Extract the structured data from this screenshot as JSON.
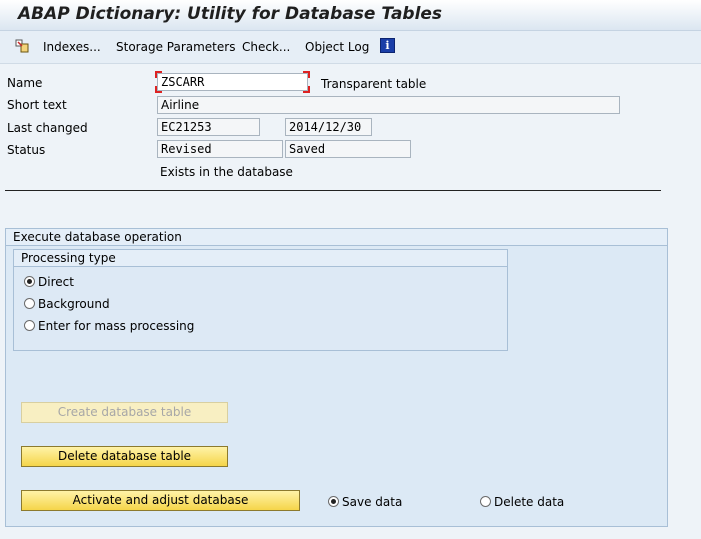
{
  "window": {
    "title": "ABAP Dictionary: Utility for Database Tables"
  },
  "toolbar": {
    "display_icon": "display-object-icon",
    "indexes_label": "Indexes...",
    "storage_label": "Storage Parameters",
    "check_label": "Check...",
    "object_log_label": "Object Log",
    "info_icon": "info-icon"
  },
  "header": {
    "name_label": "Name",
    "name_value": "ZSCARR",
    "table_type": "Transparent table",
    "short_text_label": "Short text",
    "short_text_value": "Airline",
    "last_changed_label": "Last changed",
    "last_changed_user": "EC21253",
    "last_changed_date": "2014/12/30",
    "status_label": "Status",
    "status_value1": "Revised",
    "status_value2": "Saved",
    "db_state": "Exists in the database"
  },
  "operation": {
    "group_title": "Execute database operation",
    "processing": {
      "group_title": "Processing type",
      "options": [
        {
          "label": "Direct",
          "selected": true
        },
        {
          "label": "Background",
          "selected": false
        },
        {
          "label": "Enter for mass processing",
          "selected": false
        }
      ]
    },
    "create_button": "Create database table",
    "delete_button": "Delete database table",
    "activate_button": "Activate and adjust database",
    "save_data_label": "Save data",
    "delete_data_label": "Delete data",
    "save_data_selected": true
  },
  "colors": {
    "button_yellow": "#f5d54a",
    "group_background": "#dce9f5",
    "info_blue": "#1a3ea8"
  }
}
